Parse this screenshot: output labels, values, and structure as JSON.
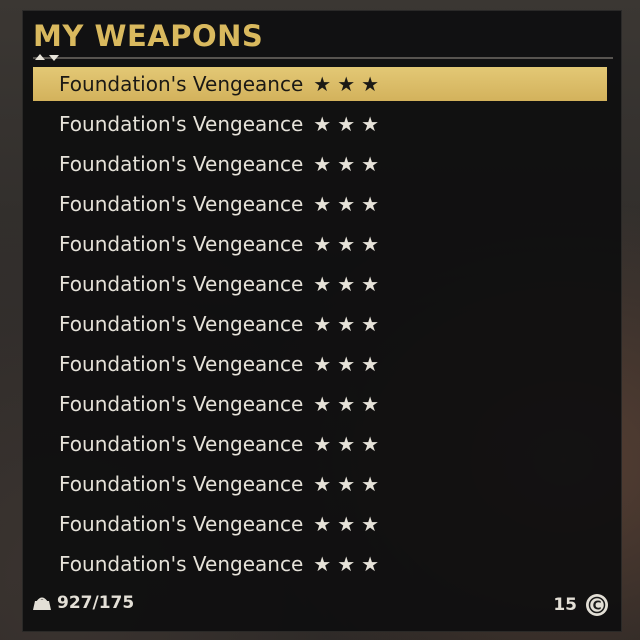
{
  "header": {
    "title": "MY WEAPONS"
  },
  "weapons": [
    {
      "name": "Foundation's Vengeance",
      "stars": "★★★",
      "selected": true
    },
    {
      "name": "Foundation's Vengeance",
      "stars": "★★★",
      "selected": false
    },
    {
      "name": "Foundation's Vengeance",
      "stars": "★★★",
      "selected": false
    },
    {
      "name": "Foundation's Vengeance",
      "stars": "★★★",
      "selected": false
    },
    {
      "name": "Foundation's Vengeance",
      "stars": "★★★",
      "selected": false
    },
    {
      "name": "Foundation's Vengeance",
      "stars": "★★★",
      "selected": false
    },
    {
      "name": "Foundation's Vengeance",
      "stars": "★★★",
      "selected": false
    },
    {
      "name": "Foundation's Vengeance",
      "stars": "★★★",
      "selected": false
    },
    {
      "name": "Foundation's Vengeance",
      "stars": "★★★",
      "selected": false
    },
    {
      "name": "Foundation's Vengeance",
      "stars": "★★★",
      "selected": false
    },
    {
      "name": "Foundation's Vengeance",
      "stars": "★★★",
      "selected": false
    },
    {
      "name": "Foundation's Vengeance",
      "stars": "★★★",
      "selected": false
    },
    {
      "name": "Foundation's Vengeance",
      "stars": "★★★",
      "selected": false
    }
  ],
  "footer": {
    "weight": "927/175",
    "weight_icon": "weight-icon",
    "caps": "15",
    "caps_icon": "bottle-cap-icon"
  },
  "colors": {
    "accent": "#d9b95e",
    "selected_row": "#dcbd67",
    "text": "#e6e2d9"
  }
}
